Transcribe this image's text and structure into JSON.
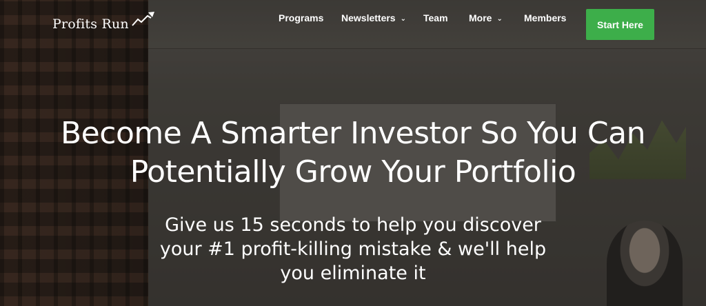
{
  "brand": {
    "name": "Profits Run",
    "logo_icon": "rising-arrow-icon"
  },
  "nav": {
    "items": [
      {
        "label": "Programs",
        "has_dropdown": false
      },
      {
        "label": "Newsletters",
        "has_dropdown": true
      },
      {
        "label": "Team",
        "has_dropdown": false
      },
      {
        "label": "More",
        "has_dropdown": true
      },
      {
        "label": "Members",
        "has_dropdown": false
      }
    ],
    "cta_label": "Start Here"
  },
  "hero": {
    "headline_line1": "Become A Smarter Investor So You Can",
    "headline_line2": "Potentially Grow Your Portfolio",
    "sub_line1": "Give us 15 seconds to help you discover",
    "sub_line2": "your #1 profit-killing mistake & we'll help",
    "sub_line3": "you eliminate it"
  },
  "colors": {
    "cta": "#3dae4a",
    "text": "#ffffff"
  }
}
